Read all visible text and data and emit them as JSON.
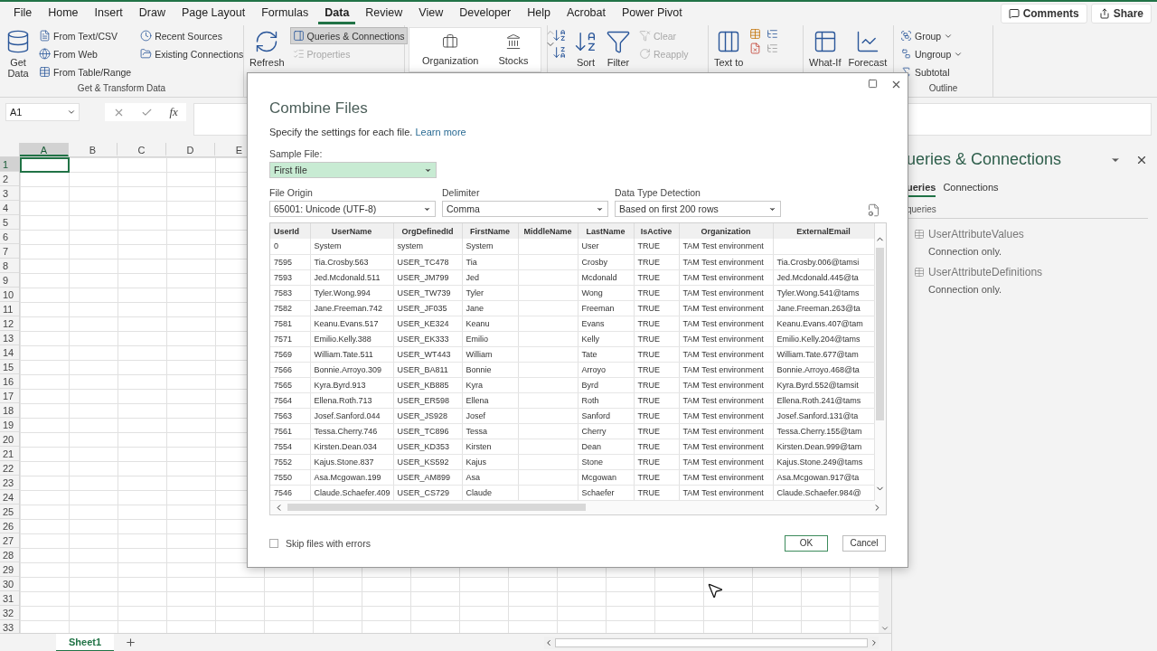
{
  "ribbon_tabs": [
    {
      "label": "File",
      "selected": false
    },
    {
      "label": "Home",
      "selected": false
    },
    {
      "label": "Insert",
      "selected": false
    },
    {
      "label": "Draw",
      "selected": false
    },
    {
      "label": "Page Layout",
      "selected": false
    },
    {
      "label": "Formulas",
      "selected": false
    },
    {
      "label": "Data",
      "selected": true
    },
    {
      "label": "Review",
      "selected": false
    },
    {
      "label": "View",
      "selected": false
    },
    {
      "label": "Developer",
      "selected": false
    },
    {
      "label": "Help",
      "selected": false
    },
    {
      "label": "Acrobat",
      "selected": false
    },
    {
      "label": "Power Pivot",
      "selected": false
    }
  ],
  "header_buttons": [
    "Comments",
    "Share"
  ],
  "ribbon_groups": [
    {
      "label": "Get & Transform Data",
      "items": [
        {
          "kind": "large",
          "label": "Get Data",
          "selected": false,
          "disabled": false
        },
        {
          "kind": "small",
          "label": "From Text/CSV",
          "selected": false,
          "disabled": false
        },
        {
          "kind": "small",
          "label": "From Web",
          "selected": false,
          "disabled": false
        },
        {
          "kind": "small",
          "label": "From Table/Range",
          "selected": false,
          "disabled": false
        },
        {
          "kind": "small",
          "label": "Recent Sources",
          "selected": false,
          "disabled": false
        },
        {
          "kind": "small",
          "label": "Existing Connections",
          "selected": false,
          "disabled": false
        }
      ]
    },
    {
      "items": [
        {
          "kind": "large",
          "label": "Refresh",
          "selected": false,
          "disabled": false
        },
        {
          "kind": "small",
          "label": "Queries & Connections",
          "selected": true,
          "disabled": false
        },
        {
          "kind": "small",
          "label": "Properties",
          "selected": false,
          "disabled": true
        }
      ]
    },
    {
      "items": [
        {
          "kind": "gallery",
          "label": "Organization"
        },
        {
          "kind": "gallery",
          "label": "Stocks"
        }
      ]
    },
    {
      "items": [
        {
          "kind": "large",
          "label": "Sort",
          "selected": false,
          "disabled": false
        },
        {
          "kind": "large",
          "label": "Filter",
          "selected": false,
          "disabled": false
        },
        {
          "kind": "small",
          "label": "Clear",
          "selected": false,
          "disabled": true
        },
        {
          "kind": "small",
          "label": "Reapply",
          "selected": false,
          "disabled": true
        }
      ]
    },
    {
      "items": [
        {
          "kind": "large",
          "label": "Text to",
          "selected": false,
          "disabled": false
        }
      ]
    },
    {
      "items": [
        {
          "kind": "large",
          "label": "What-If",
          "selected": false,
          "disabled": false
        },
        {
          "kind": "large",
          "label": "Forecast",
          "selected": false,
          "disabled": false
        }
      ]
    },
    {
      "label": "Outline",
      "items": [
        {
          "kind": "small",
          "label": "Group",
          "selected": false,
          "disabled": false
        },
        {
          "kind": "small",
          "label": "Ungroup",
          "selected": false,
          "disabled": false
        },
        {
          "kind": "small",
          "label": "Subtotal",
          "selected": false,
          "disabled": false
        }
      ]
    }
  ],
  "formula_bar": {
    "name_box": "A1",
    "function_label": "fx"
  },
  "sheet": {
    "columns": [
      {
        "label": "A",
        "selected": true
      },
      {
        "label": "B",
        "selected": false
      },
      {
        "label": "C",
        "selected": false
      },
      {
        "label": "D",
        "selected": false
      },
      {
        "label": "E",
        "selected": false
      }
    ],
    "rows": [
      {
        "label": "1",
        "selected": true
      },
      {
        "label": "2",
        "selected": false
      },
      {
        "label": "3",
        "selected": false
      },
      {
        "label": "4",
        "selected": false
      },
      {
        "label": "5",
        "selected": false
      },
      {
        "label": "6",
        "selected": false
      },
      {
        "label": "7",
        "selected": false
      },
      {
        "label": "8",
        "selected": false
      },
      {
        "label": "9",
        "selected": false
      },
      {
        "label": "10",
        "selected": false
      },
      {
        "label": "11",
        "selected": false
      },
      {
        "label": "12",
        "selected": false
      },
      {
        "label": "13",
        "selected": false
      },
      {
        "label": "14",
        "selected": false
      },
      {
        "label": "15",
        "selected": false
      },
      {
        "label": "16",
        "selected": false
      },
      {
        "label": "17",
        "selected": false
      },
      {
        "label": "18",
        "selected": false
      },
      {
        "label": "19",
        "selected": false
      },
      {
        "label": "20",
        "selected": false
      },
      {
        "label": "21",
        "selected": false
      },
      {
        "label": "22",
        "selected": false
      },
      {
        "label": "23",
        "selected": false
      },
      {
        "label": "24",
        "selected": false
      },
      {
        "label": "25",
        "selected": false
      },
      {
        "label": "26",
        "selected": false
      },
      {
        "label": "27",
        "selected": false
      },
      {
        "label": "28",
        "selected": false
      },
      {
        "label": "29",
        "selected": false
      },
      {
        "label": "30",
        "selected": false
      },
      {
        "label": "31",
        "selected": false
      },
      {
        "label": "32",
        "selected": false
      },
      {
        "label": "33",
        "selected": false
      }
    ],
    "tabs": [
      {
        "label": "Sheet1",
        "selected": true
      }
    ]
  },
  "queries_pane": {
    "title": "ueries & Connections",
    "tabs": [
      {
        "label": "ueries",
        "selected": true
      },
      {
        "label": "Connections",
        "selected": false
      }
    ],
    "count": "queries",
    "items": [
      {
        "name": "UserAttributeValues",
        "status": "Connection only."
      },
      {
        "name": "UserAttributeDefinitions",
        "status": "Connection only."
      }
    ]
  },
  "dialog": {
    "title": "Combine Files",
    "subtitle": "Specify the settings for each file.",
    "link": "Learn more",
    "sample_file": {
      "label": "Sample File:",
      "value": "First file"
    },
    "fields": [
      {
        "label": "File Origin",
        "value": "65001: Unicode (UTF-8)"
      },
      {
        "label": "Delimiter",
        "value": "Comma"
      },
      {
        "label": "Data Type Detection",
        "value": "Based on first 200 rows"
      }
    ],
    "table": {
      "columns": [
        "UserId",
        "UserName",
        "OrgDefinedId",
        "FirstName",
        "MiddleName",
        "LastName",
        "IsActive",
        "Organization",
        "ExternalEmail"
      ],
      "rows": [
        [
          "0",
          "System",
          "system",
          "System",
          "",
          "User",
          "TRUE",
          "TAM Test environment",
          ""
        ],
        [
          "7595",
          "Tia.Crosby.563",
          "USER_TC478",
          "Tia",
          "",
          "Crosby",
          "TRUE",
          "TAM Test environment",
          "Tia.Crosby.006@tamsi"
        ],
        [
          "7593",
          "Jed.Mcdonald.511",
          "USER_JM799",
          "Jed",
          "",
          "Mcdonald",
          "TRUE",
          "TAM Test environment",
          "Jed.Mcdonald.445@ta"
        ],
        [
          "7583",
          "Tyler.Wong.994",
          "USER_TW739",
          "Tyler",
          "",
          "Wong",
          "TRUE",
          "TAM Test environment",
          "Tyler.Wong.541@tams"
        ],
        [
          "7582",
          "Jane.Freeman.742",
          "USER_JF035",
          "Jane",
          "",
          "Freeman",
          "TRUE",
          "TAM Test environment",
          "Jane.Freeman.263@ta"
        ],
        [
          "7581",
          "Keanu.Evans.517",
          "USER_KE324",
          "Keanu",
          "",
          "Evans",
          "TRUE",
          "TAM Test environment",
          "Keanu.Evans.407@tam"
        ],
        [
          "7571",
          "Emilio.Kelly.388",
          "USER_EK333",
          "Emilio",
          "",
          "Kelly",
          "TRUE",
          "TAM Test environment",
          "Emilio.Kelly.204@tams"
        ],
        [
          "7569",
          "William.Tate.511",
          "USER_WT443",
          "William",
          "",
          "Tate",
          "TRUE",
          "TAM Test environment",
          "William.Tate.677@tam"
        ],
        [
          "7566",
          "Bonnie.Arroyo.309",
          "USER_BA811",
          "Bonnie",
          "",
          "Arroyo",
          "TRUE",
          "TAM Test environment",
          "Bonnie.Arroyo.468@ta"
        ],
        [
          "7565",
          "Kyra.Byrd.913",
          "USER_KB885",
          "Kyra",
          "",
          "Byrd",
          "TRUE",
          "TAM Test environment",
          "Kyra.Byrd.552@tamsit"
        ],
        [
          "7564",
          "Ellena.Roth.713",
          "USER_ER598",
          "Ellena",
          "",
          "Roth",
          "TRUE",
          "TAM Test environment",
          "Ellena.Roth.241@tams"
        ],
        [
          "7563",
          "Josef.Sanford.044",
          "USER_JS928",
          "Josef",
          "",
          "Sanford",
          "TRUE",
          "TAM Test environment",
          "Josef.Sanford.131@ta"
        ],
        [
          "7561",
          "Tessa.Cherry.746",
          "USER_TC896",
          "Tessa",
          "",
          "Cherry",
          "TRUE",
          "TAM Test environment",
          "Tessa.Cherry.155@tam"
        ],
        [
          "7554",
          "Kirsten.Dean.034",
          "USER_KD353",
          "Kirsten",
          "",
          "Dean",
          "TRUE",
          "TAM Test environment",
          "Kirsten.Dean.999@tam"
        ],
        [
          "7552",
          "Kajus.Stone.837",
          "USER_KS592",
          "Kajus",
          "",
          "Stone",
          "TRUE",
          "TAM Test environment",
          "Kajus.Stone.249@tams"
        ],
        [
          "7550",
          "Asa.Mcgowan.199",
          "USER_AM899",
          "Asa",
          "",
          "Mcgowan",
          "TRUE",
          "TAM Test environment",
          "Asa.Mcgowan.917@ta"
        ],
        [
          "7546",
          "Claude.Schaefer.409",
          "USER_CS729",
          "Claude",
          "",
          "Schaefer",
          "TRUE",
          "TAM Test environment",
          "Claude.Schaefer.984@"
        ]
      ]
    },
    "skip_option": {
      "label": "Skip files with errors",
      "checked": false
    },
    "buttons": [
      {
        "label": "OK",
        "default": true
      },
      {
        "label": "Cancel",
        "default": false
      }
    ]
  }
}
